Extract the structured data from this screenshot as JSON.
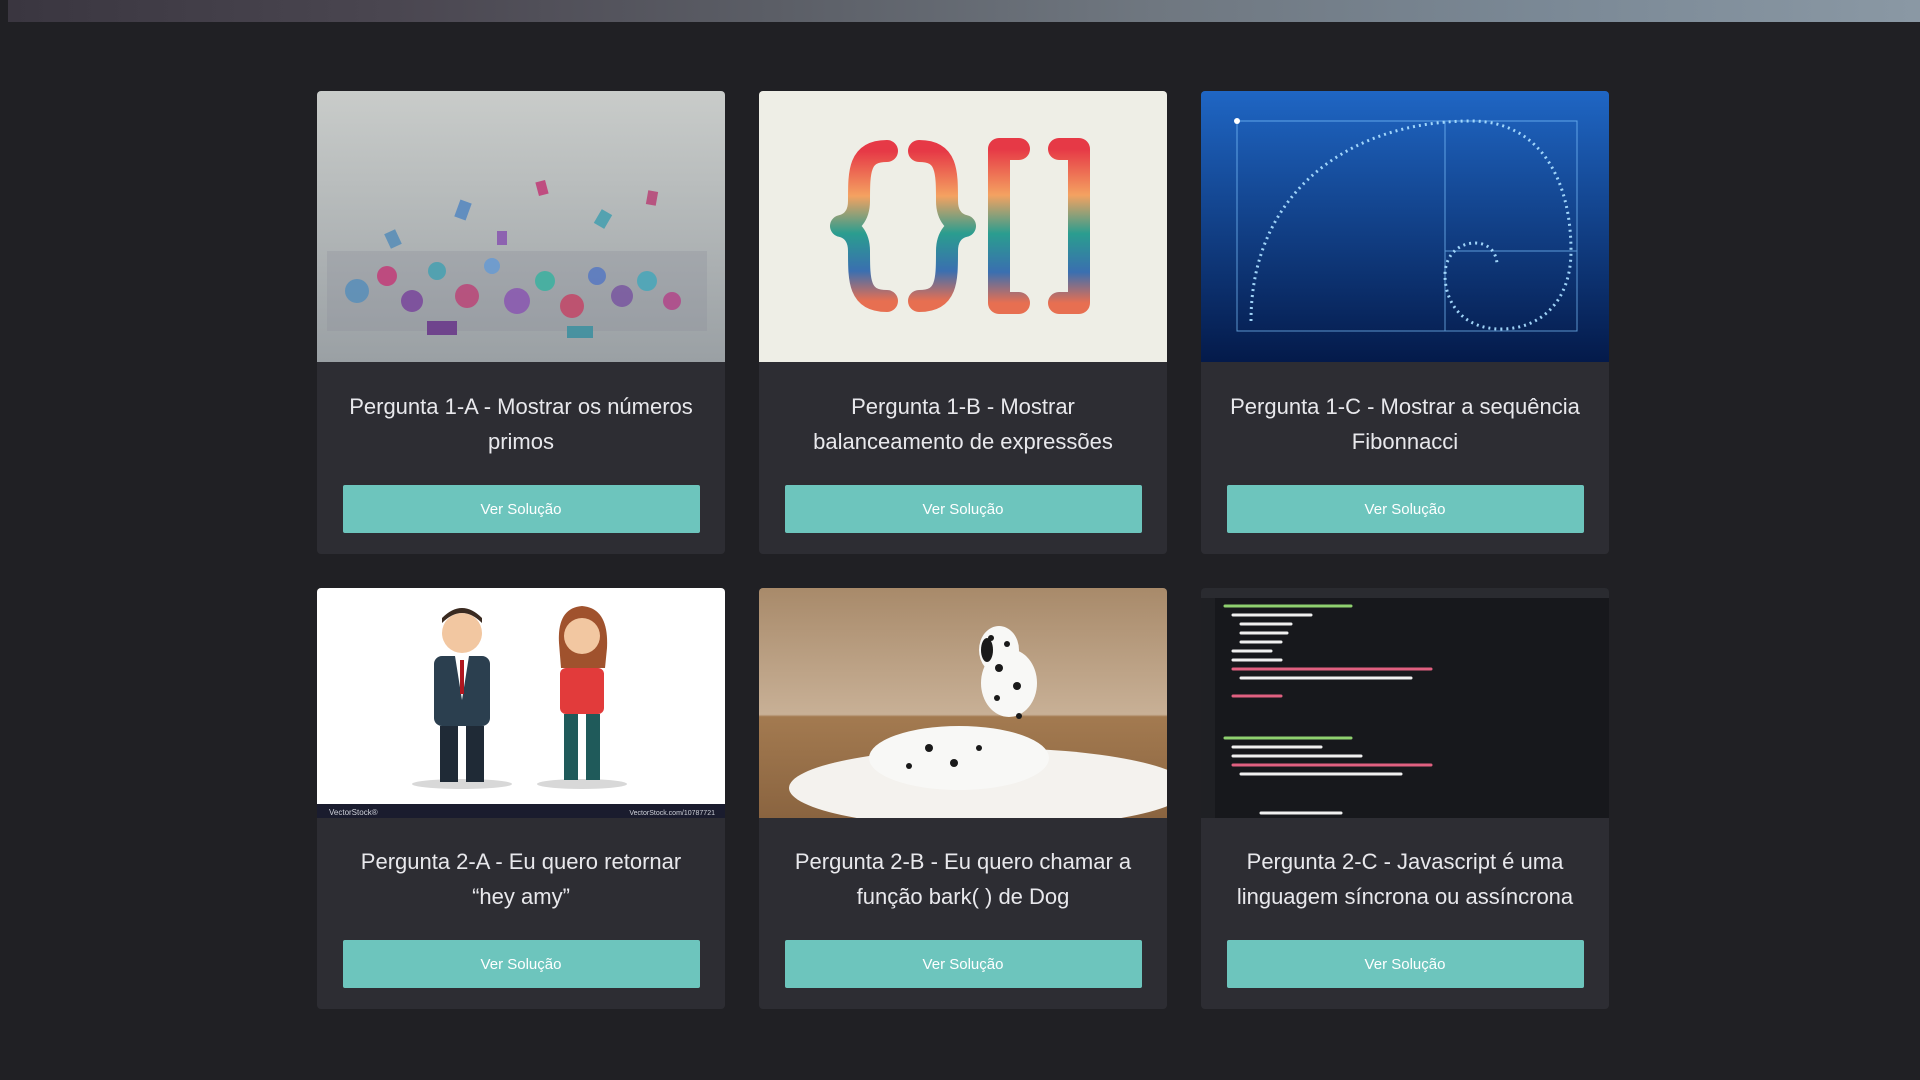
{
  "cards": [
    {
      "title": "Pergunta 1-A - Mostrar os números primos",
      "button_label": "Ver Solução",
      "image_subject": "scattered-3d-numbers"
    },
    {
      "title": "Pergunta 1-B - Mostrar balanceamento de expressões",
      "button_label": "Ver Solução",
      "image_subject": "curly-and-square-brackets"
    },
    {
      "title": "Pergunta 1-C - Mostrar a sequência Fibonnacci",
      "button_label": "Ver Solução",
      "image_subject": "golden-spiral"
    },
    {
      "title": "Pergunta 2-A - Eu quero retornar “hey amy”",
      "button_label": "Ver Solução",
      "image_subject": "man-and-woman-illustration",
      "image_watermark": "VectorStock®",
      "image_watermark_url": "VectorStock.com/10787721"
    },
    {
      "title": "Pergunta 2-B - Eu quero chamar a função bark( ) de Dog",
      "button_label": "Ver Solução",
      "image_subject": "dalmatian-dog"
    },
    {
      "title": "Pergunta 2-C - Javascript é uma linguagem síncrona ou assíncrona",
      "button_label": "Ver Solução",
      "image_subject": "code-editor"
    }
  ],
  "colors": {
    "page_background": "#202024",
    "card_background": "#2d2d33",
    "button_background": "#6dc5bd",
    "title_text": "#e8e8ec"
  }
}
